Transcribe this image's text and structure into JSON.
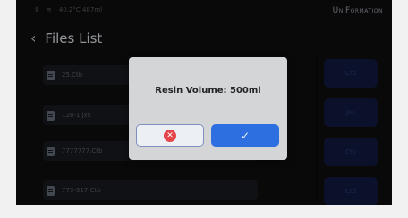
{
  "status": {
    "left_text": "40.2°C 487ml",
    "brand": "UniFormation"
  },
  "header": {
    "back_symbol": "‹",
    "title": "Files List"
  },
  "files": [
    {
      "name": "25.Ctb"
    },
    {
      "name": "128-1.jxs"
    },
    {
      "name": "7777777.Ctb"
    },
    {
      "name": "773-317.Ctb"
    }
  ],
  "side_buttons": [
    {
      "label": "Ctb"
    },
    {
      "label": "Jxs"
    },
    {
      "label": "Ctb"
    },
    {
      "label": "Ctb"
    }
  ],
  "dialog": {
    "message": "Resin Volume: 500ml",
    "confirm_symbol": "✓",
    "cancel_symbol": "✕"
  },
  "colors": {
    "confirm_blue": "#2d6fe0",
    "cancel_red": "#e4464a",
    "dialog_bg": "#d4d5d7",
    "screen_bg": "#0f0f10"
  }
}
